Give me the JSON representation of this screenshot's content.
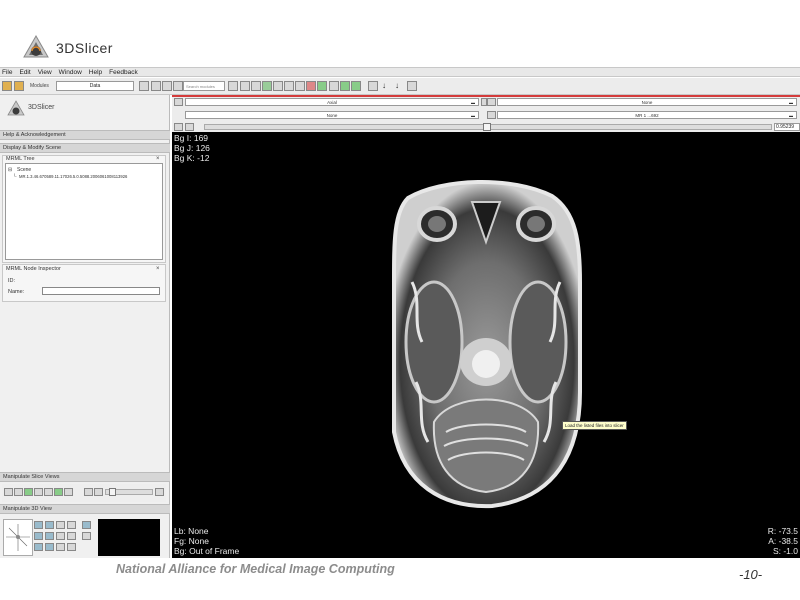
{
  "app": {
    "logo_text": "3DSlicer",
    "small_logo_text": "3DSlicer"
  },
  "menu": {
    "items": [
      "File",
      "Edit",
      "View",
      "Window",
      "Help",
      "Feedback"
    ]
  },
  "toolbar": {
    "modules_label": "Modules",
    "modules_value": "Data",
    "search_placeholder": "Search modules"
  },
  "slice_controls": {
    "orientation": "Axial",
    "background_left": "None",
    "foreground_right": "None",
    "background_right": "MR 1 ...692",
    "offset_value": "0.95239"
  },
  "panel": {
    "help_header": "Help & Acknowledgement",
    "display_header": "Display & Modify Scene",
    "mrml_tree_title": "MRML Tree",
    "tree_root": "Scene",
    "tree_child": "MR.1.3.46.670589.11.17026.5.0.5088.2006061008113926",
    "inspector_title": "MRML Node Inspector",
    "id_label": "ID:",
    "name_label": "Name:",
    "manipulate_slice_header": "Manipulate Slice Views",
    "manipulate_3d_header": "Manipulate 3D View"
  },
  "viewer": {
    "bg_i": "Bg I: 169",
    "bg_j": "Bg J: 126",
    "bg_k": "Bg K: -12",
    "lb": "Lb: None",
    "fg": "Fg: None",
    "bg": "Bg: Out of Frame",
    "r": "R: -73.5",
    "a": "A: -38.5",
    "s": "S: -1.0",
    "tooltip": "Load the listed files into slicer"
  },
  "footer": {
    "organization": "National Alliance for Medical Image Computing",
    "page_number": "-10-"
  },
  "colors": {
    "slice_red": "#d43b3b",
    "footer_gray": "#8c8c8c"
  }
}
